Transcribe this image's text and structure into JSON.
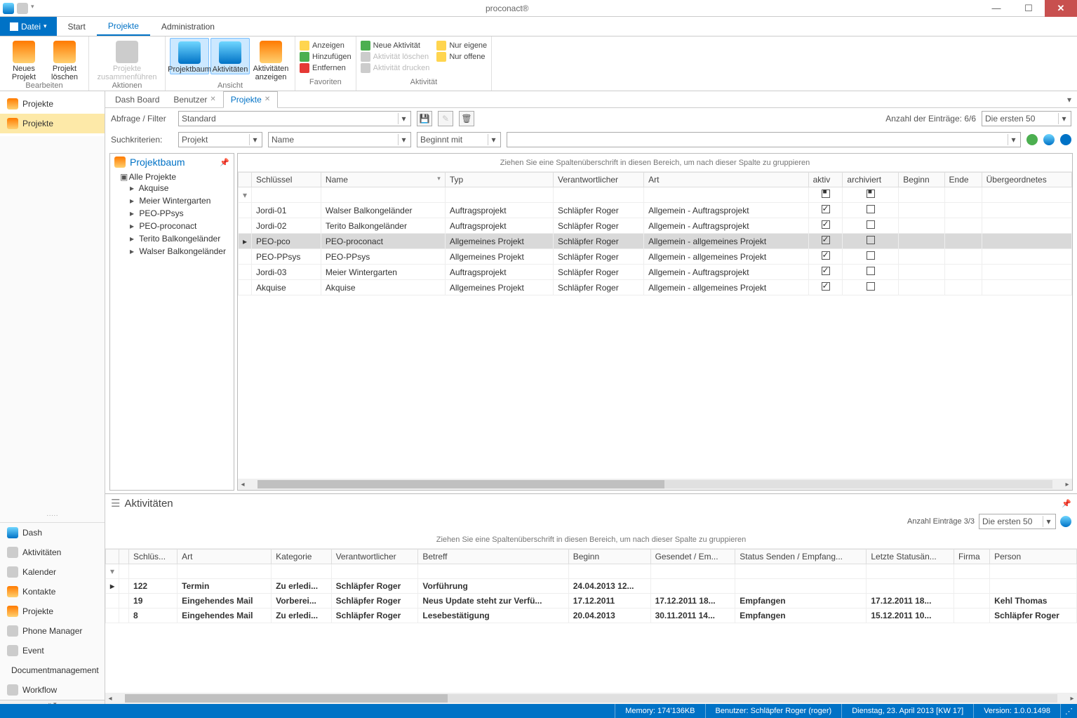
{
  "app_title": "proconact®",
  "ribbon": {
    "file": "Datei",
    "tabs": [
      "Start",
      "Projekte",
      "Administration"
    ],
    "active_tab": "Projekte",
    "groups": {
      "bearbeiten": {
        "label": "Bearbeiten",
        "neues_projekt": "Neues\nProjekt",
        "projekt_loeschen": "Projekt\nlöschen"
      },
      "aktionen": {
        "label": "Aktionen",
        "zusammen": "Projekte\nzusammenführen"
      },
      "ansicht": {
        "label": "Ansicht",
        "projektbaum": "Projektbaum",
        "aktivitaeten": "Aktivitäten",
        "akt_anzeigen": "Aktivitäten\nanzeigen"
      },
      "favoriten": {
        "label": "Favoriten",
        "anzeigen": "Anzeigen",
        "hinzu": "Hinzufügen",
        "entfernen": "Entfernen"
      },
      "aktivitaet": {
        "label": "Aktivität",
        "neue": "Neue Aktivität",
        "loeschen": "Aktivität löschen",
        "drucken": "Aktivität drucken",
        "eigene": "Nur eigene",
        "offene": "Nur offene"
      }
    }
  },
  "left": {
    "top_items": [
      "Projekte",
      "Projekte"
    ],
    "selected_top": 1,
    "nav": [
      "Dash",
      "Aktivitäten",
      "Kalender",
      "Kontakte",
      "Projekte",
      "Phone Manager",
      "Event",
      "Documentmanagement",
      "Workflow"
    ]
  },
  "doc_tabs": {
    "tabs": [
      "Dash Board",
      "Benutzer",
      "Projekte"
    ],
    "active": 2
  },
  "filter": {
    "abfrage_label": "Abfrage / Filter",
    "abfrage_value": "Standard",
    "such_label": "Suchkriterien:",
    "field1": "Projekt",
    "field2": "Name",
    "op": "Beginnt mit",
    "count_label": "Anzahl der Einträge: 6/6",
    "page_sel": "Die ersten 50"
  },
  "tree": {
    "title": "Projektbaum",
    "root": "Alle Projekte",
    "items": [
      "Akquise",
      "Meier Wintergarten",
      "PEO-PPsys",
      "PEO-proconact",
      "Terito Balkongeländer",
      "Walser Balkongeländer"
    ]
  },
  "grid": {
    "group_hint": "Ziehen Sie eine Spaltenüberschrift in diesen Bereich, um nach dieser Spalte zu gruppieren",
    "cols": [
      "Schlüssel",
      "Name",
      "Typ",
      "Verantwortlicher",
      "Art",
      "aktiv",
      "archiviert",
      "Beginn",
      "Ende",
      "Übergeordnetes"
    ],
    "rows": [
      {
        "k": "Jordi-01",
        "n": "Walser Balkongeländer",
        "t": "Auftragsprojekt",
        "v": "Schläpfer Roger",
        "a": "Allgemein - Auftragsprojekt",
        "ak": true,
        "ar": false
      },
      {
        "k": "Jordi-02",
        "n": "Terito Balkongeländer",
        "t": "Auftragsprojekt",
        "v": "Schläpfer Roger",
        "a": "Allgemein - Auftragsprojekt",
        "ak": true,
        "ar": false
      },
      {
        "k": "PEO-pco",
        "n": "PEO-proconact",
        "t": "Allgemeines Projekt",
        "v": "Schläpfer Roger",
        "a": "Allgemein - allgemeines Projekt",
        "ak": true,
        "ar": false,
        "sel": true
      },
      {
        "k": "PEO-PPsys",
        "n": "PEO-PPsys",
        "t": "Allgemeines Projekt",
        "v": "Schläpfer Roger",
        "a": "Allgemein - allgemeines Projekt",
        "ak": true,
        "ar": false
      },
      {
        "k": "Jordi-03",
        "n": "Meier Wintergarten",
        "t": "Auftragsprojekt",
        "v": "Schläpfer Roger",
        "a": "Allgemein - Auftragsprojekt",
        "ak": true,
        "ar": false
      },
      {
        "k": "Akquise",
        "n": "Akquise",
        "t": "Allgemeines Projekt",
        "v": "Schläpfer Roger",
        "a": "Allgemein - allgemeines Projekt",
        "ak": true,
        "ar": false
      }
    ]
  },
  "activities": {
    "title": "Aktivitäten",
    "count_label": "Anzahl Einträge 3/3",
    "page_sel": "Die ersten 50",
    "group_hint": "Ziehen Sie eine Spaltenüberschrift in diesen Bereich, um nach dieser Spalte zu gruppieren",
    "cols": [
      "Schlüs...",
      "Art",
      "Kategorie",
      "Verantwortlicher",
      "Betreff",
      "Beginn",
      "Gesendet / Em...",
      "Status Senden / Empfang...",
      "Letzte Statusän...",
      "Firma",
      "Person"
    ],
    "rows": [
      {
        "k": "122",
        "art": "Termin",
        "kat": "Zu erledi...",
        "ver": "Schläpfer Roger",
        "bet": "Vorführung",
        "beg": "24.04.2013 12...",
        "ges": "",
        "st": "",
        "ls": "",
        "fi": "",
        "pe": "",
        "bold": true,
        "ptr": true
      },
      {
        "k": "19",
        "art": "Eingehendes Mail",
        "kat": "Vorberei...",
        "ver": "Schläpfer Roger",
        "bet": "Neus Update steht zur Verfü...",
        "beg": "17.12.2011",
        "ges": "17.12.2011 18...",
        "st": "Empfangen",
        "ls": "17.12.2011 18...",
        "fi": "",
        "pe": "Kehl Thomas",
        "bold": true
      },
      {
        "k": "8",
        "art": "Eingehendes Mail",
        "kat": "Zu erledi...",
        "ver": "Schläpfer Roger",
        "bet": "Lesebestätigung",
        "beg": "20.04.2013",
        "ges": "30.11.2011 14...",
        "st": "Empfangen",
        "ls": "15.12.2011 10...",
        "fi": "",
        "pe": "Schläpfer Roger",
        "bold": true
      }
    ]
  },
  "status": {
    "memory": "Memory: 174'136KB",
    "user": "Benutzer: Schläpfer Roger (roger)",
    "date": "Dienstag, 23. April 2013 [KW 17]",
    "version": "Version: 1.0.0.1498"
  }
}
